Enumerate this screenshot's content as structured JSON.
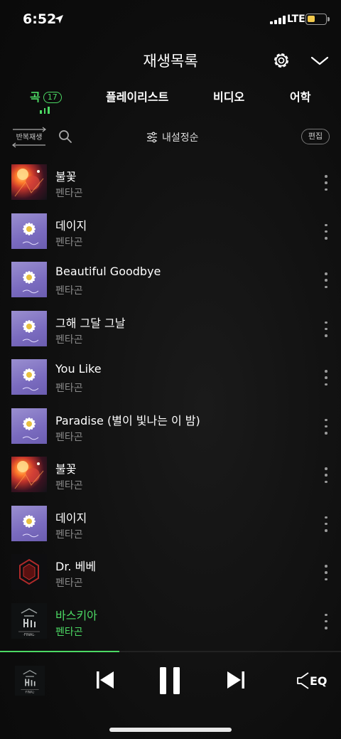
{
  "status_bar": {
    "time": "6:52",
    "network": "LTE",
    "battery_level": 0.45
  },
  "header": {
    "title": "재생목록",
    "settings_icon": "gear-icon",
    "collapse_icon": "chevron-down-icon"
  },
  "tabs": [
    {
      "label": "곡",
      "count": "17",
      "active": true
    },
    {
      "label": "플레이리스트",
      "active": false
    },
    {
      "label": "비디오",
      "active": false
    },
    {
      "label": "어학",
      "active": false
    }
  ],
  "controls": {
    "repeat_label": "반복재생",
    "sort_label": "내설정순",
    "edit_label": "편집"
  },
  "tracks": [
    {
      "title": "불꽃",
      "artist": "펜타곤",
      "art": "fire",
      "playing": false
    },
    {
      "title": "데이지",
      "artist": "펜타곤",
      "art": "daisy",
      "playing": false
    },
    {
      "title": "Beautiful Goodbye",
      "artist": "펜타곤",
      "art": "daisy",
      "playing": false
    },
    {
      "title": "그해 그달 그날",
      "artist": "펜타곤",
      "art": "daisy",
      "playing": false
    },
    {
      "title": "You Like",
      "artist": "펜타곤",
      "art": "daisy",
      "playing": false
    },
    {
      "title": "Paradise (별이 빛나는 이 밤)",
      "artist": "펜타곤",
      "art": "daisy",
      "playing": false
    },
    {
      "title": "불꽃",
      "artist": "펜타곤",
      "art": "fire",
      "playing": false
    },
    {
      "title": "데이지",
      "artist": "펜타곤",
      "art": "daisy",
      "playing": false
    },
    {
      "title": "Dr. 베베",
      "artist": "펜타곤",
      "art": "red",
      "playing": false
    },
    {
      "title": "바스키아",
      "artist": "펜타곤",
      "art": "final",
      "playing": true
    }
  ],
  "player": {
    "progress": 0.35,
    "eq_label": "EQ"
  },
  "colors": {
    "accent": "#4cd964",
    "background": "#0d0d0d",
    "muted_text": "#8a8a8a"
  }
}
